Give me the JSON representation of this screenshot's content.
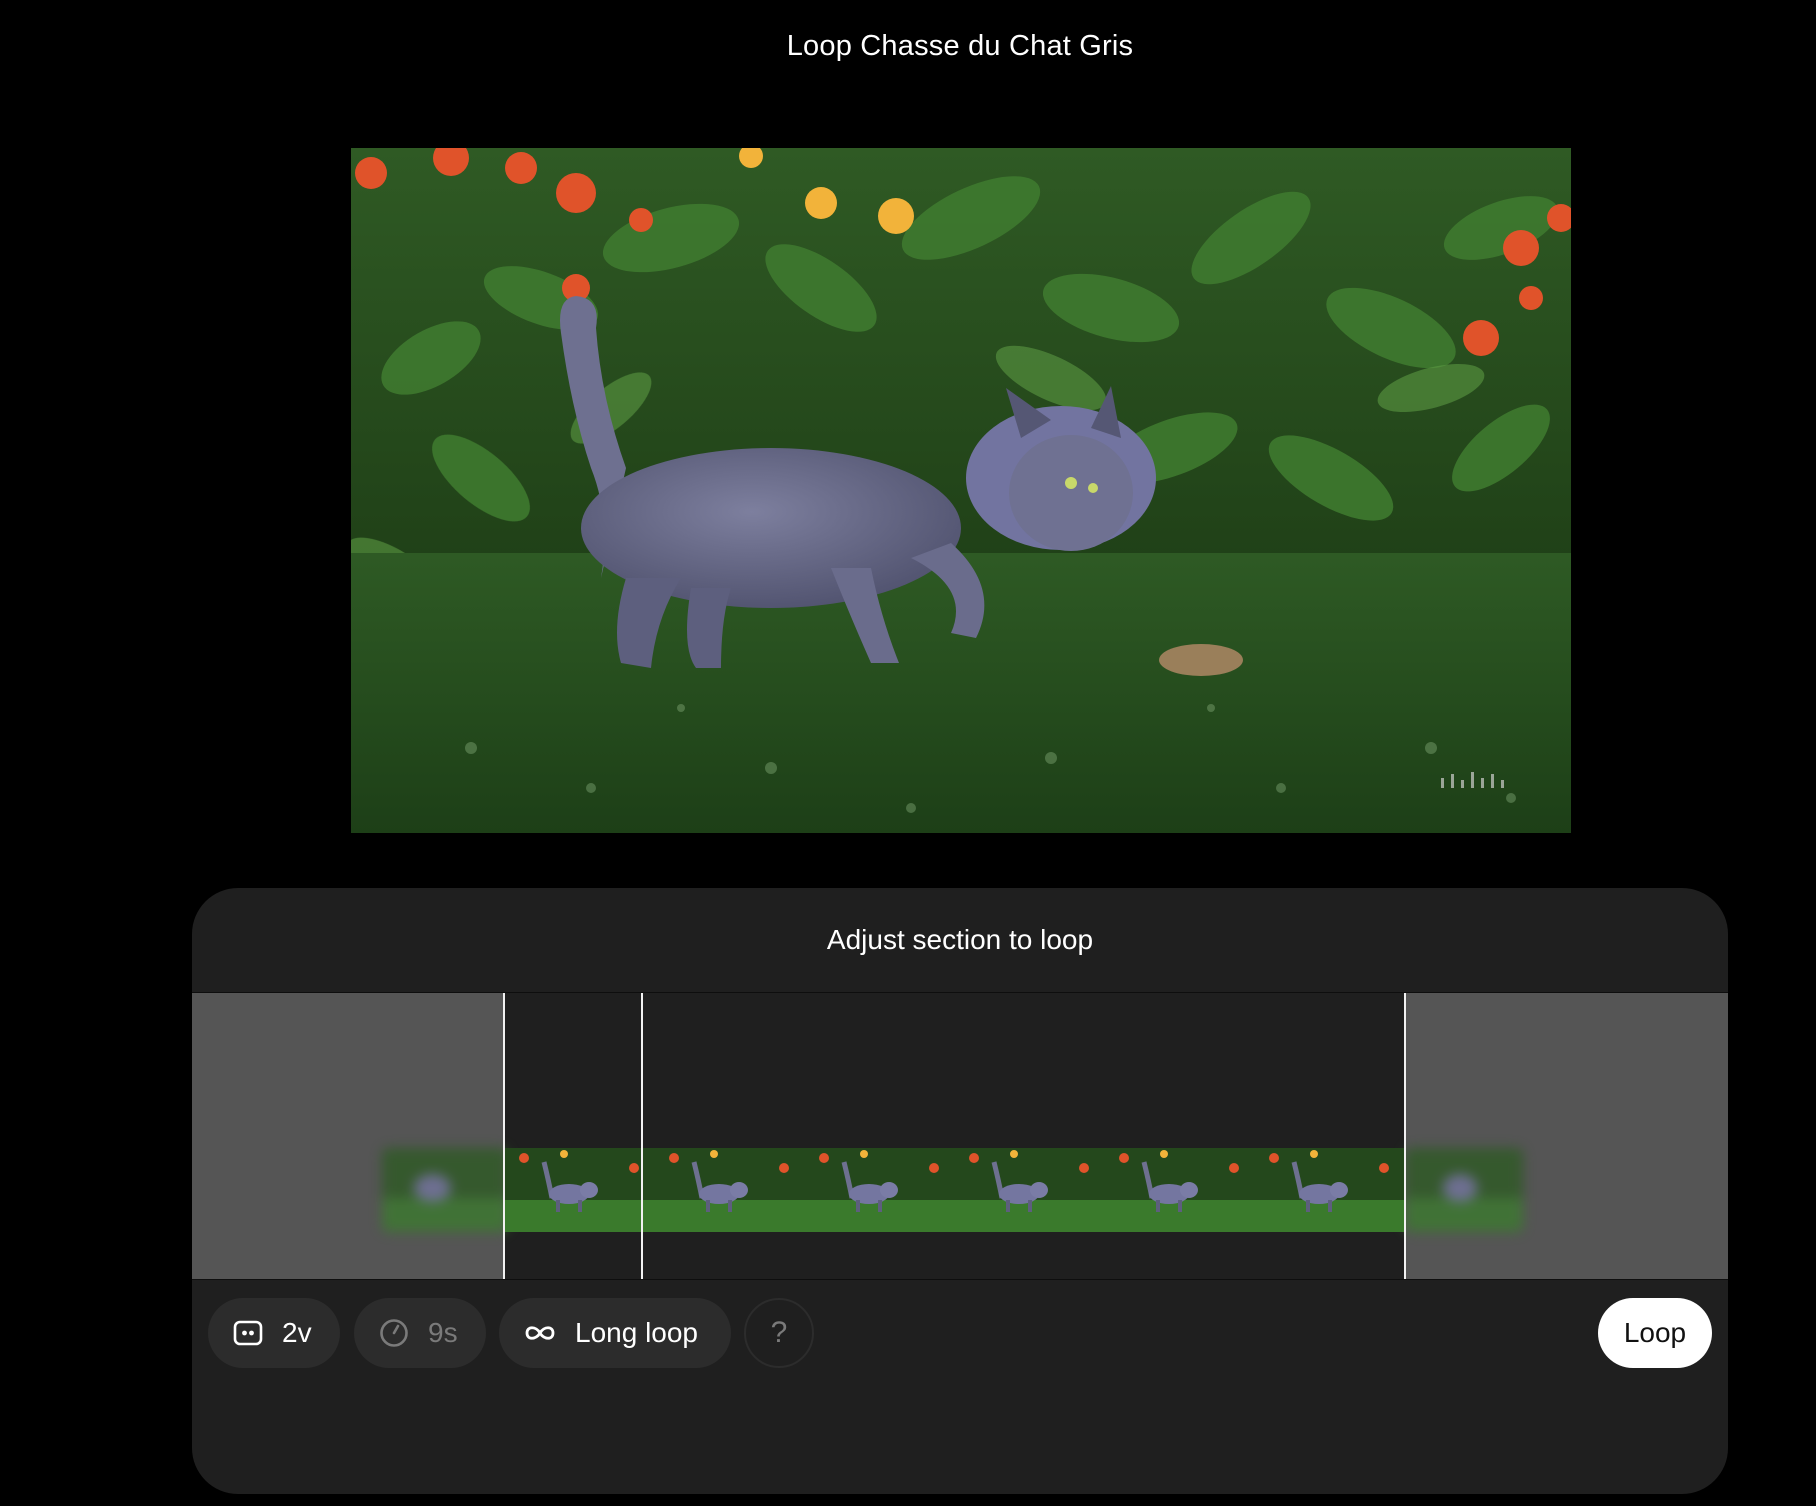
{
  "page": {
    "title": "Loop Chasse du Chat Gris"
  },
  "panel": {
    "title": "Adjust section to loop",
    "thumbnail_count": 7
  },
  "toolbar": {
    "frames_label": "2v",
    "frames_icon": "face-box-icon",
    "duration_label": "9s",
    "duration_icon": "timer-icon",
    "mode_label": "Long loop",
    "mode_icon": "infinity-icon",
    "help_label": "?",
    "loop_button_label": "Loop"
  },
  "colors": {
    "background": "#000000",
    "panel": "#1f1f1f",
    "pill": "#2c2c2c",
    "dimmed_track": "#555555",
    "primary_button": "#ffffff"
  }
}
